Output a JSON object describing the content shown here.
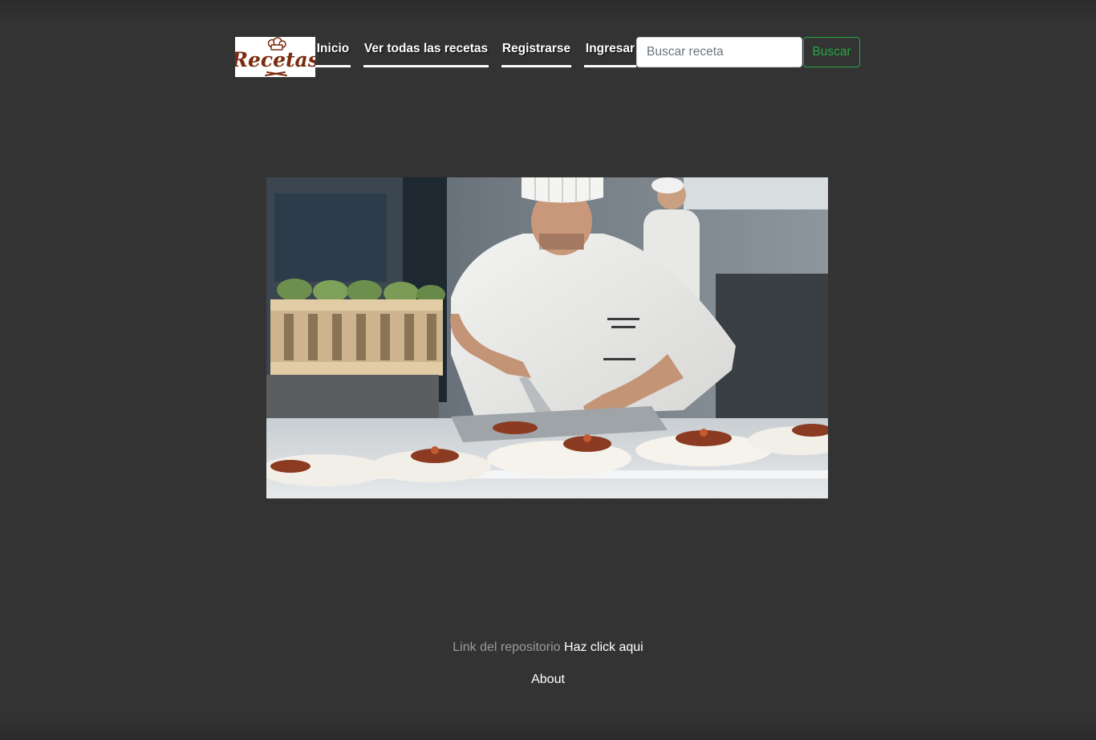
{
  "header": {
    "logo_text": "Recetas",
    "nav": {
      "inicio": "Inicio",
      "todas": "Ver todas las recetas",
      "registrarse": "Registrarse",
      "ingresar": "Ingresar"
    },
    "search": {
      "placeholder": "Buscar receta",
      "value": "",
      "button_label": "Buscar"
    }
  },
  "hero": {
    "alt": "Chef plating dishes in a professional kitchen"
  },
  "footer": {
    "repo_label": "Link del repositorio",
    "repo_link": "Haz click aqui",
    "about": "About"
  },
  "colors": {
    "background": "#333333",
    "search_accent": "#28a745",
    "logo_brown": "#7a2a0e"
  }
}
